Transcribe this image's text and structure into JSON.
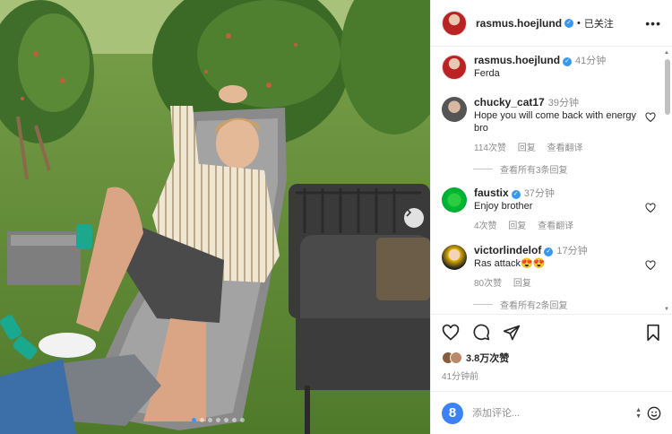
{
  "post": {
    "author": "rasmus.hoejlund",
    "follow_label": "已关注",
    "separator": "•",
    "more_icon": "•••",
    "caption": "Ferda",
    "caption_time": "41分钟",
    "carousel": {
      "slides": 7,
      "active": 0
    }
  },
  "comments": [
    {
      "user": "chucky_cat17",
      "verified": false,
      "time": "39分钟",
      "text": "Hope you will come back with energy bro",
      "likes": "114次赞",
      "reply": "回复",
      "translate": "查看翻译",
      "replies": "查看所有3条回复"
    },
    {
      "user": "faustix",
      "verified": true,
      "time": "37分钟",
      "text": "Enjoy brother",
      "likes": "4次赞",
      "reply": "回复",
      "translate": "查看翻译",
      "replies": ""
    },
    {
      "user": "victorlindelof",
      "verified": true,
      "time": "17分钟",
      "text": "Ras attack😍😍",
      "likes": "80次赞",
      "reply": "回复",
      "translate": "",
      "replies": "查看所有2条回复"
    }
  ],
  "stats": {
    "likes": "3.8万次赞",
    "posted": "41分钟前"
  },
  "composer": {
    "placeholder": "添加评论..."
  },
  "colors": {
    "accent": "#3897f0",
    "text": "#262626",
    "muted": "#8e8e8e"
  }
}
